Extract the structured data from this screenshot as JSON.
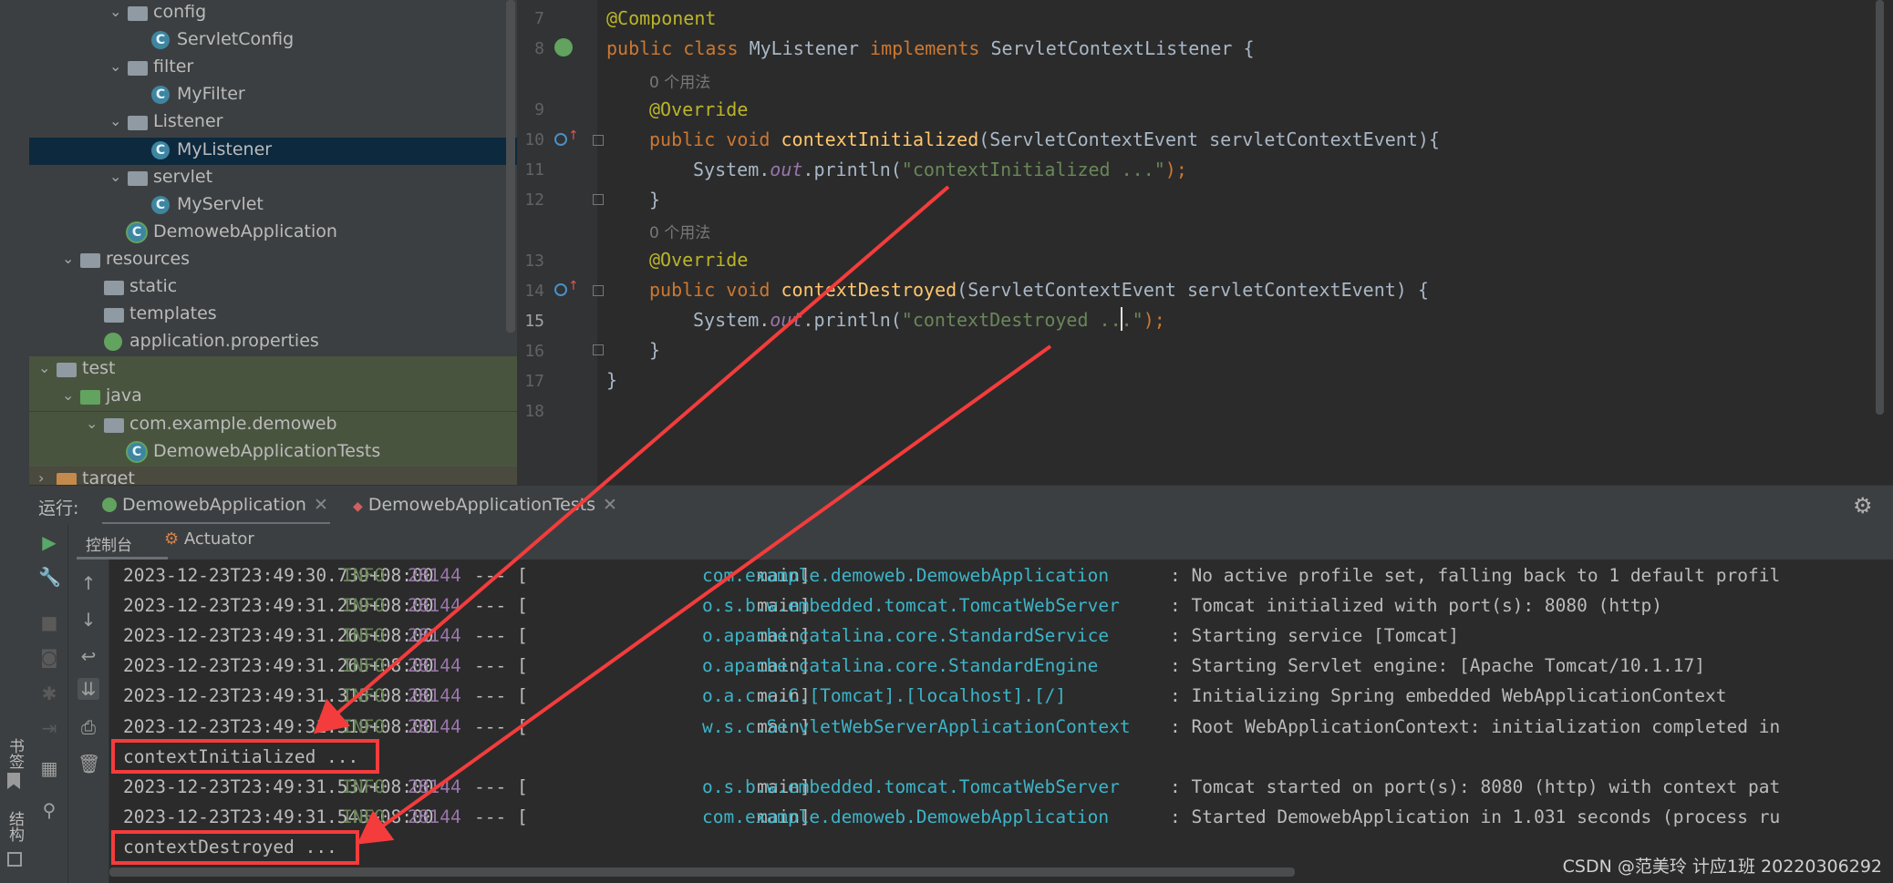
{
  "project_tree": {
    "items": [
      {
        "label": "config",
        "type": "folder",
        "expanded": true
      },
      {
        "label": "ServletConfig",
        "type": "class"
      },
      {
        "label": "filter",
        "type": "folder",
        "expanded": true
      },
      {
        "label": "MyFilter",
        "type": "class"
      },
      {
        "label": "Listener",
        "type": "folder",
        "expanded": true
      },
      {
        "label": "MyListener",
        "type": "class",
        "selected": true
      },
      {
        "label": "servlet",
        "type": "folder",
        "expanded": true
      },
      {
        "label": "MyServlet",
        "type": "class"
      },
      {
        "label": "DemowebApplication",
        "type": "spring-class"
      },
      {
        "label": "resources",
        "type": "resources-folder",
        "expanded": true
      },
      {
        "label": "static",
        "type": "folder"
      },
      {
        "label": "templates",
        "type": "folder"
      },
      {
        "label": "application.properties",
        "type": "properties"
      },
      {
        "label": "test",
        "type": "folder",
        "expanded": true
      },
      {
        "label": "java",
        "type": "test-folder",
        "expanded": true
      },
      {
        "label": "com.example.demoweb",
        "type": "package",
        "expanded": true
      },
      {
        "label": "DemowebApplicationTests",
        "type": "spring-class"
      },
      {
        "label": "target",
        "type": "excluded-folder",
        "expanded": false
      }
    ]
  },
  "editor": {
    "line_numbers": [
      "7",
      "8",
      "9",
      "10",
      "11",
      "12",
      "13",
      "14",
      "15",
      "16",
      "17",
      "18"
    ],
    "hint": "0 个用法",
    "code": {
      "l7": "@Component",
      "l8_kw1": "public",
      "l8_kw2": "class",
      "l8_name": "MyListener",
      "l8_kw3": "implements",
      "l8_iface": "ServletContextListener {",
      "override": "@Override",
      "l10_kw": "public void",
      "l10_fn": "contextInitialized",
      "l10_rest": "(ServletContextEvent servletContextEvent){",
      "l11_a": "System.",
      "l11_out": "out",
      "l11_b": ".println(",
      "l11_str": "\"contextInitialized ...\"",
      "l11_c": ");",
      "close": "}",
      "l14_kw": "public void",
      "l14_fn": "contextDestroyed",
      "l14_rest": "(ServletContextEvent servletContextEvent) {",
      "l15_a": "System.",
      "l15_out": "out",
      "l15_b": ".println(",
      "l15_str": "\"contextDestroyed ...\"",
      "l15_c": ");"
    }
  },
  "run_panel": {
    "label": "运行:",
    "tabs": [
      "DemowebApplication",
      "DemowebApplicationTests"
    ],
    "subtabs": [
      "控制台",
      "Actuator"
    ],
    "console_lines": [
      {
        "ts": "2023-12-23T23:49:30.739+08:00",
        "level": "INFO",
        "pid": "28144",
        "sep": "--- [",
        "thread": "main]",
        "logger": "com.example.demoweb.DemowebApplication",
        "msg": ": No active profile set, falling back to 1 default profil"
      },
      {
        "ts": "2023-12-23T23:49:31.259+08:00",
        "level": "INFO",
        "pid": "28144",
        "sep": "--- [",
        "thread": "main]",
        "logger": "o.s.b.w.embedded.tomcat.TomcatWebServer",
        "msg": ": Tomcat initialized with port(s): 8080 (http)"
      },
      {
        "ts": "2023-12-23T23:49:31.265+08:00",
        "level": "INFO",
        "pid": "28144",
        "sep": "--- [",
        "thread": "main]",
        "logger": "o.apache.catalina.core.StandardService",
        "msg": ": Starting service [Tomcat]"
      },
      {
        "ts": "2023-12-23T23:49:31.265+08:00",
        "level": "INFO",
        "pid": "28144",
        "sep": "--- [",
        "thread": "main]",
        "logger": "o.apache.catalina.core.StandardEngine",
        "msg": ": Starting Servlet engine: [Apache Tomcat/10.1.17]"
      },
      {
        "ts": "2023-12-23T23:49:31.318+08:00",
        "level": "INFO",
        "pid": "28144",
        "sep": "--- [",
        "thread": "main]",
        "logger": "o.a.c.c.C.[Tomcat].[localhost].[/]",
        "msg": ": Initializing Spring embedded WebApplicationContext"
      },
      {
        "ts": "2023-12-23T23:49:31.319+08:00",
        "level": "INFO",
        "pid": "28144",
        "sep": "--- [",
        "thread": "main]",
        "logger": "w.s.c.ServletWebServerApplicationContext",
        "msg": ": Root WebApplicationContext: initialization completed in"
      },
      {
        "plain": "contextInitialized ..."
      },
      {
        "ts": "2023-12-23T23:49:31.537+08:00",
        "level": "INFO",
        "pid": "28144",
        "sep": "--- [",
        "thread": "main]",
        "logger": "o.s.b.w.embedded.tomcat.TomcatWebServer",
        "msg": ": Tomcat started on port(s): 8080 (http) with context pat"
      },
      {
        "ts": "2023-12-23T23:49:31.543+08:00",
        "level": "INFO",
        "pid": "28144",
        "sep": "--- [",
        "thread": "main]",
        "logger": "com.example.demoweb.DemowebApplication",
        "msg": ": Started DemowebApplication in 1.031 seconds (process ru"
      },
      {
        "plain": "contextDestroyed ..."
      }
    ]
  },
  "side_strip": {
    "bookmarks": "书签",
    "structure": "结构"
  },
  "watermark": "CSDN @范美玲 计应1班 20220306292",
  "colors": {
    "annotation_red": "#f43c3c",
    "selection": "#0d293e",
    "test_bg": "#49543f"
  }
}
